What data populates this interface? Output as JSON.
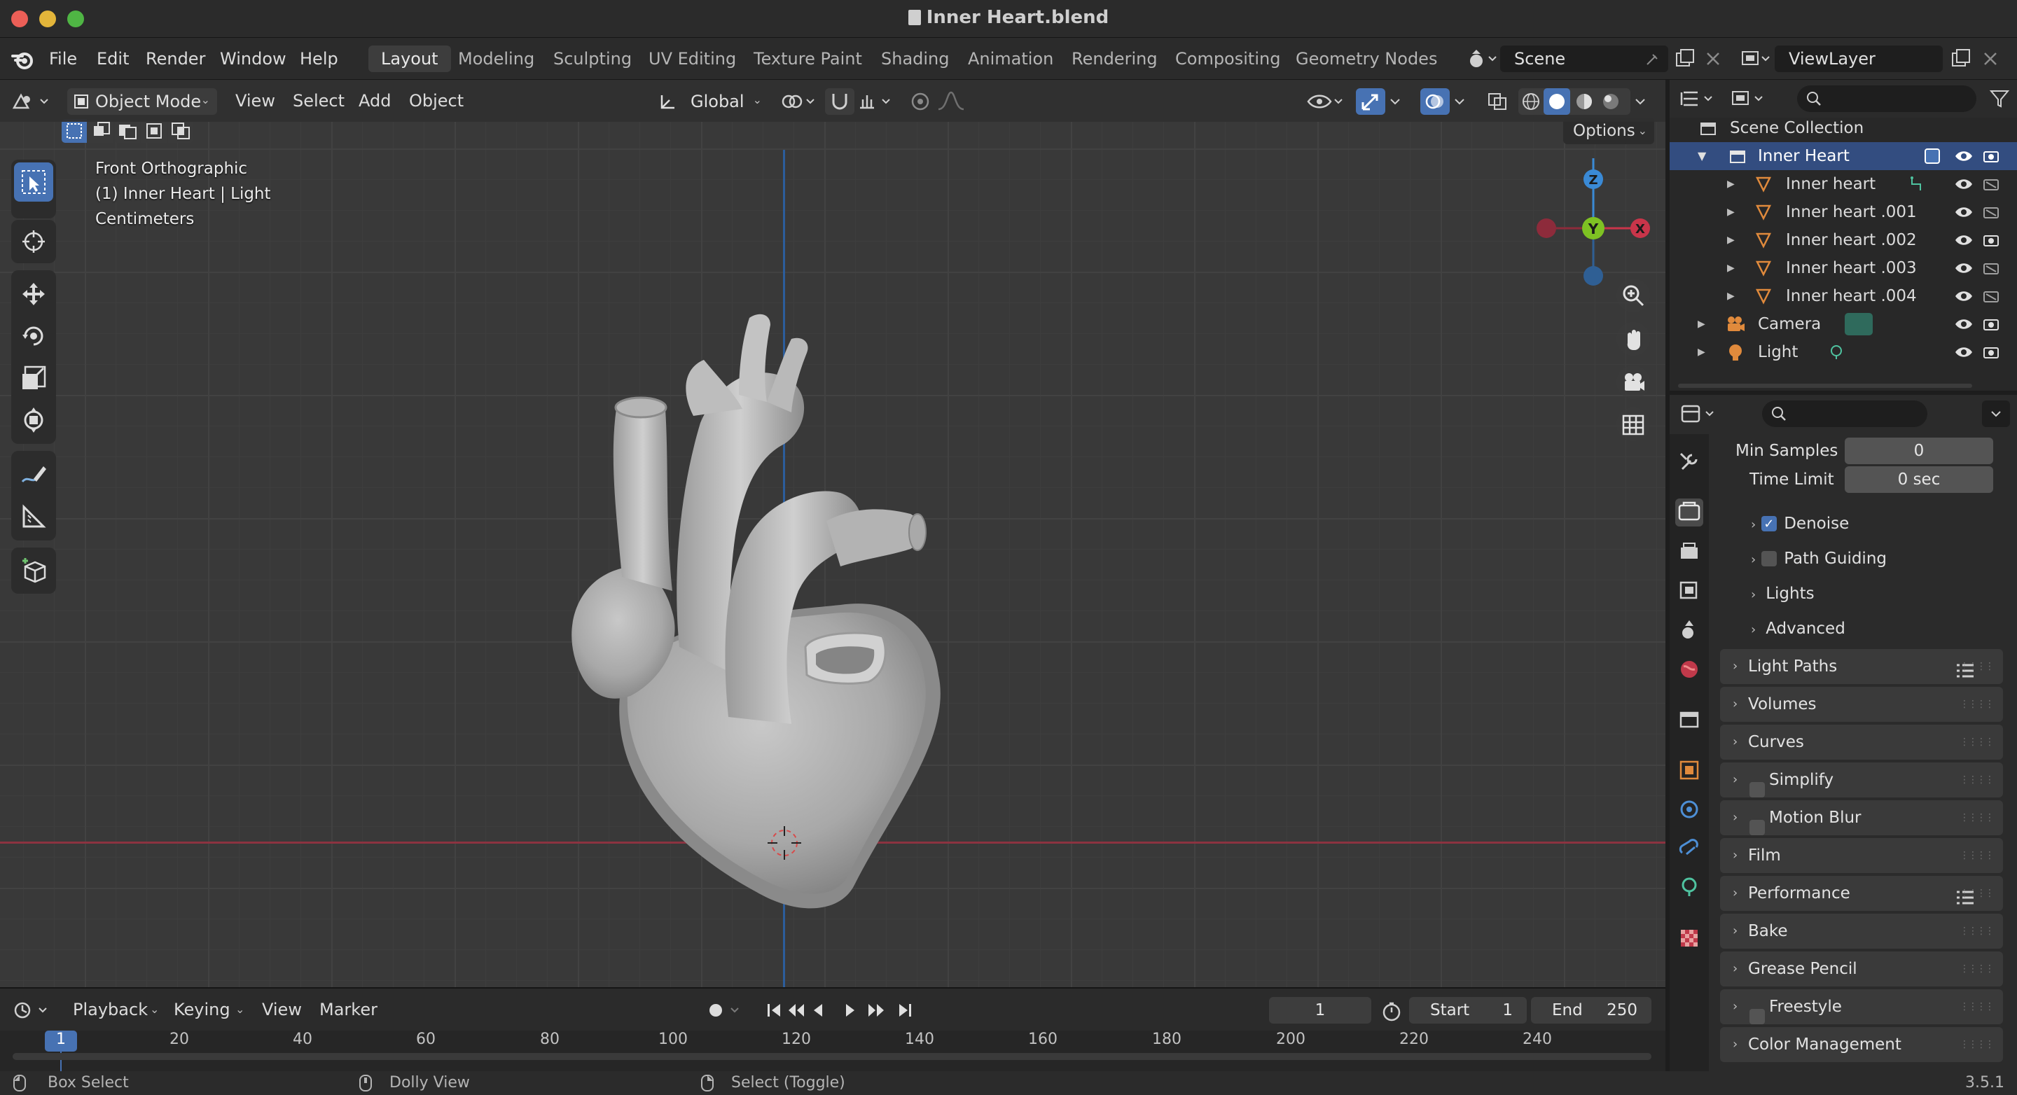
{
  "window": {
    "title": "Inner Heart.blend"
  },
  "menubar": {
    "items": [
      "File",
      "Edit",
      "Render",
      "Window",
      "Help"
    ],
    "workspaces": [
      "Layout",
      "Modeling",
      "Sculpting",
      "UV Editing",
      "Texture Paint",
      "Shading",
      "Animation",
      "Rendering",
      "Compositing",
      "Geometry Nodes"
    ],
    "active_workspace": "Layout",
    "scene": "Scene",
    "view_layer": "ViewLayer"
  },
  "viewport": {
    "mode": "Object Mode",
    "menus": [
      "View",
      "Select",
      "Add",
      "Object"
    ],
    "transform_orientation": "Global",
    "options_label": "Options",
    "overlay_lines": [
      "Front Orthographic",
      "(1) Inner Heart | Light",
      "Centimeters"
    ],
    "gizmo_axes": {
      "z": "Z",
      "y": "Y",
      "x": "X"
    }
  },
  "outliner": {
    "root": "Scene Collection",
    "collection": "Inner Heart",
    "objects": [
      "Inner heart",
      "Inner heart .001",
      "Inner heart .002",
      "Inner heart .003",
      "Inner heart .004"
    ],
    "camera": "Camera",
    "light": "Light"
  },
  "properties": {
    "min_samples_label": "Min Samples",
    "min_samples_value": "0",
    "time_limit_label": "Time Limit",
    "time_limit_value": "0 sec",
    "subpanels": [
      {
        "label": "Denoise",
        "checkbox": true,
        "checked": true
      },
      {
        "label": "Path Guiding",
        "checkbox": true,
        "checked": false
      },
      {
        "label": "Lights",
        "checkbox": false
      },
      {
        "label": "Advanced",
        "checkbox": false
      }
    ],
    "panels": [
      {
        "label": "Light Paths",
        "checkbox": false
      },
      {
        "label": "Volumes",
        "checkbox": false
      },
      {
        "label": "Curves",
        "checkbox": false
      },
      {
        "label": "Simplify",
        "checkbox": true
      },
      {
        "label": "Motion Blur",
        "checkbox": true
      },
      {
        "label": "Film",
        "checkbox": false
      },
      {
        "label": "Performance",
        "checkbox": false
      },
      {
        "label": "Bake",
        "checkbox": false
      },
      {
        "label": "Grease Pencil",
        "checkbox": false
      },
      {
        "label": "Freestyle",
        "checkbox": true
      },
      {
        "label": "Color Management",
        "checkbox": false
      }
    ]
  },
  "timeline": {
    "menus": [
      "Playback",
      "Keying",
      "View",
      "Marker"
    ],
    "current_frame": "1",
    "start_label": "Start",
    "start_value": "1",
    "end_label": "End",
    "end_value": "250",
    "ticks": [
      "1",
      "20",
      "40",
      "60",
      "80",
      "100",
      "120",
      "140",
      "160",
      "180",
      "200",
      "220",
      "240"
    ]
  },
  "statusbar": {
    "hints": [
      "Box Select",
      "Dolly View",
      "Select (Toggle)"
    ],
    "version": "3.5.1"
  },
  "colors": {
    "accent": "#4772b3",
    "axis_x": "#c9354a",
    "axis_y": "#7ec223",
    "axis_z": "#3a8ad6",
    "object_icon": "#e08a3c"
  }
}
